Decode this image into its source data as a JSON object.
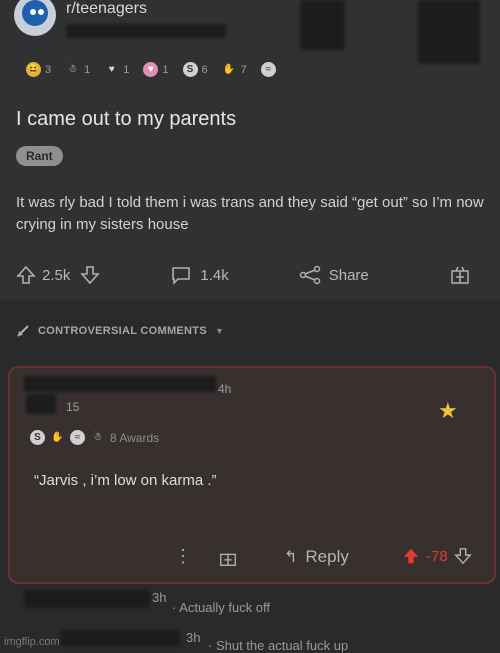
{
  "post": {
    "subreddit": "r/teenagers",
    "awards": [
      {
        "icon": "laughing-emoji-icon",
        "count": "3",
        "color": "#d9b53a"
      },
      {
        "icon": "mascot-award-icon",
        "count": "1",
        "color": "#e6e6e6"
      },
      {
        "icon": "heart-eyes-award-icon",
        "count": "1",
        "color": "#d9d9d9"
      },
      {
        "icon": "heart-award-icon",
        "count": "1",
        "color": "#e58fb0"
      },
      {
        "icon": "silver-award-icon",
        "count": "6",
        "color": "#d0d0d0"
      },
      {
        "icon": "hands-award-icon",
        "count": "7",
        "color": "#cfcfcf"
      },
      {
        "icon": "wave-award-icon",
        "count": "",
        "color": "#d0d0d0"
      }
    ],
    "title": "I came out to my parents",
    "flair": "Rant",
    "body": "It was rly bad I told them i was trans and they said “get out” so I’m now crying in my sisters house",
    "upvotes": "2.5k",
    "comments": "1.4k",
    "share_label": "Share"
  },
  "sort": {
    "label": "CONTROVERSIAL COMMENTS"
  },
  "comment": {
    "time": "4h",
    "score": "15",
    "awards_label": "8 Awards",
    "text": "“Jarvis , i’m low on karma .”",
    "reply_label": "Reply",
    "votes": "-78"
  },
  "replies": [
    {
      "time": "3h",
      "text": "· Actually fuck off"
    },
    {
      "time": "3h",
      "text": "· Shut the actual fuck up"
    }
  ],
  "watermark": "imgflip.com",
  "colors": {
    "background": "#2a2a2c",
    "highlight_border": "#6b3130",
    "downvote": "#e23a2f"
  }
}
